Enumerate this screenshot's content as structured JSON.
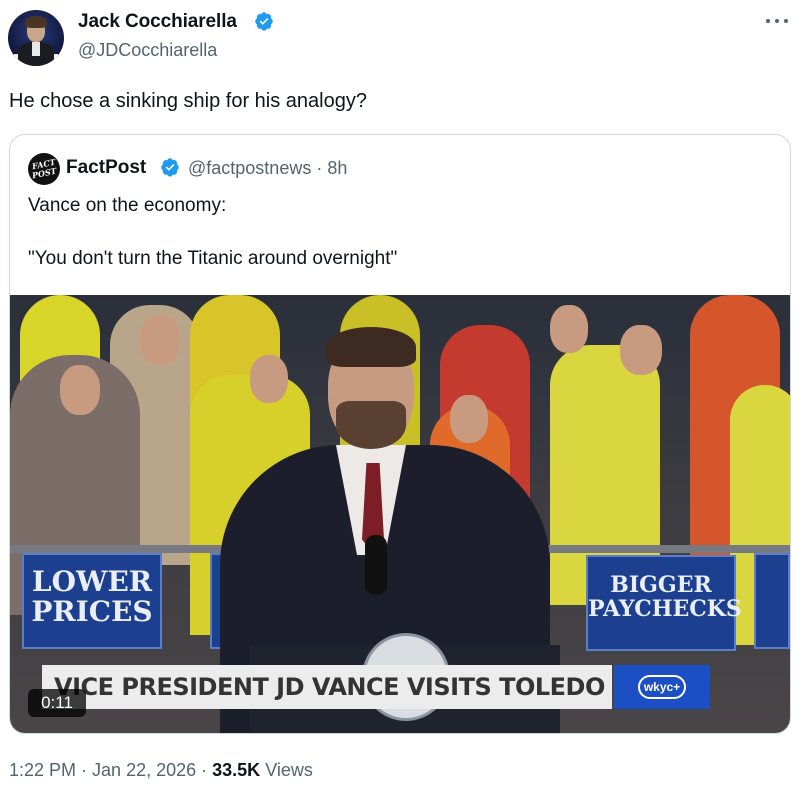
{
  "author": {
    "display_name": "Jack Cocchiarella",
    "handle": "@JDCocchiarella",
    "avatar": "profile-photo"
  },
  "tweet": {
    "text": "He chose a sinking ship for his analogy?"
  },
  "quoted_tweet": {
    "logo_line1": "FACT",
    "logo_line2": "POST",
    "display_name": "FactPost",
    "handle_and_time": "@factpostnews · 8h",
    "line1": "Vance on the economy:",
    "line2": "\"You don't turn the Titanic around overnight\"",
    "video": {
      "sign_left_line1": "LOWER",
      "sign_left_line2": "PRICES",
      "sign_right_line1": "BIGGER",
      "sign_right_line2": "PAYCHECKS",
      "chyron": "VICE PRESIDENT JD VANCE VISITS TOLEDO",
      "station_logo": "wkyc+",
      "timestamp": "0:11"
    }
  },
  "footer": {
    "time": "1:22 PM",
    "separator1": " · ",
    "date": "Jan 22, 2026",
    "separator2": " · ",
    "views_count": "33.5K",
    "views_label": " Views"
  },
  "colors": {
    "verified_blue": "#1d9bf0",
    "secondary_text": "#536471",
    "border": "#cfd9de"
  }
}
